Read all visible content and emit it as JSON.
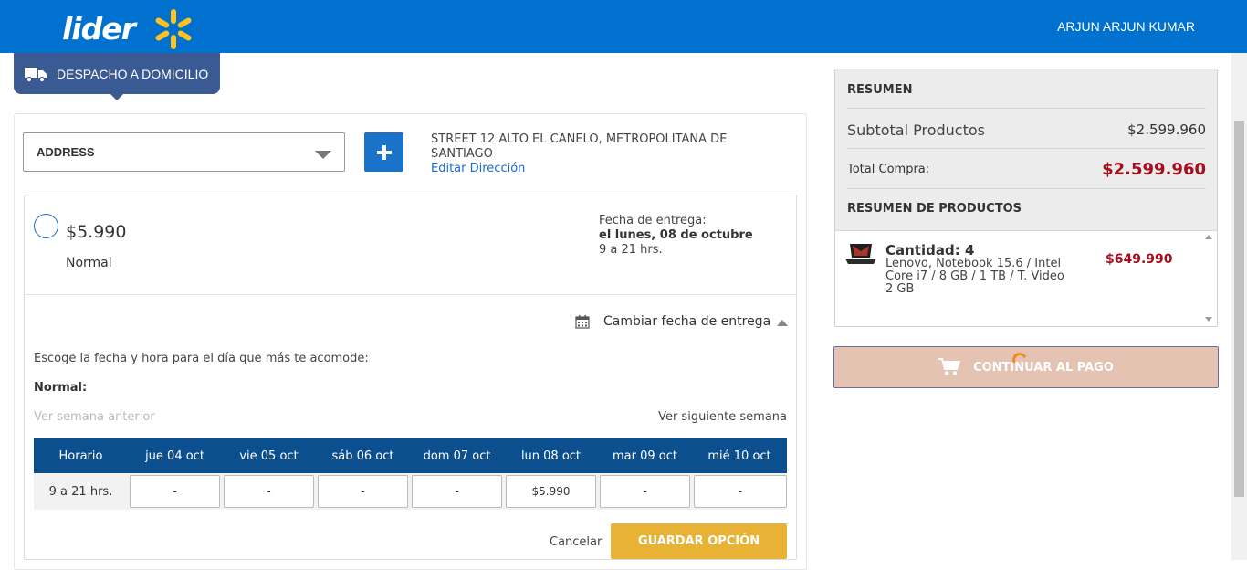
{
  "header": {
    "logo_text": "lider",
    "user_name": "ARJUN  ARJUN KUMAR",
    "brand_color": "#0071ce",
    "spark_color": "#ffc220"
  },
  "delivery_tab": {
    "label": "DESPACHO A DOMICILIO",
    "icon": "truck-icon"
  },
  "address": {
    "select_value": "ADDRESS",
    "add_icon": "plus-icon",
    "text": "STREET 12 ALTO EL CANELO, METROPOLITANA DE SANTIAGO",
    "edit_link": "Editar Dirección"
  },
  "option": {
    "price": "$5.990",
    "name": "Normal",
    "fecha_label": "Fecha de entrega:",
    "fecha_date": "el lunes, 08 de octubre",
    "fecha_hours": "9 a 21 hrs."
  },
  "change_date": {
    "label": "Cambiar fecha de entrega",
    "icon": "calendar-icon",
    "intro": "Escoge la fecha y hora para el día que más te acomode:",
    "type_label": "Normal:",
    "prev_week": "Ver semana anterior",
    "next_week": "Ver siguiente semana"
  },
  "schedule": {
    "header": [
      "Horario",
      "jue 04 oct",
      "vie 05 oct",
      "sáb 06 oct",
      "dom 07 oct",
      "lun 08 oct",
      "mar 09 oct",
      "mié 10 oct"
    ],
    "row_label": "9 a 21 hrs.",
    "cells": [
      "-",
      "-",
      "-",
      "-",
      "$5.990",
      "-",
      "-"
    ]
  },
  "actions": {
    "cancel": "Cancelar",
    "save": "GUARDAR OPCIÓN"
  },
  "summary": {
    "title": "RESUMEN",
    "subtotal_label": "Subtotal Productos",
    "subtotal_value": "$2.599.960",
    "total_label": "Total Compra:",
    "total_value": "$2.599.960",
    "products_title": "RESUMEN DE PRODUCTOS",
    "product": {
      "qty": "Cantidad: 4",
      "desc": "Lenovo, Notebook 15.6 / Intel Core i7 / 8 GB / 1 TB / T. Video 2 GB",
      "price": "$649.990"
    },
    "continue_label": "CONTINUAR AL PAGO"
  }
}
